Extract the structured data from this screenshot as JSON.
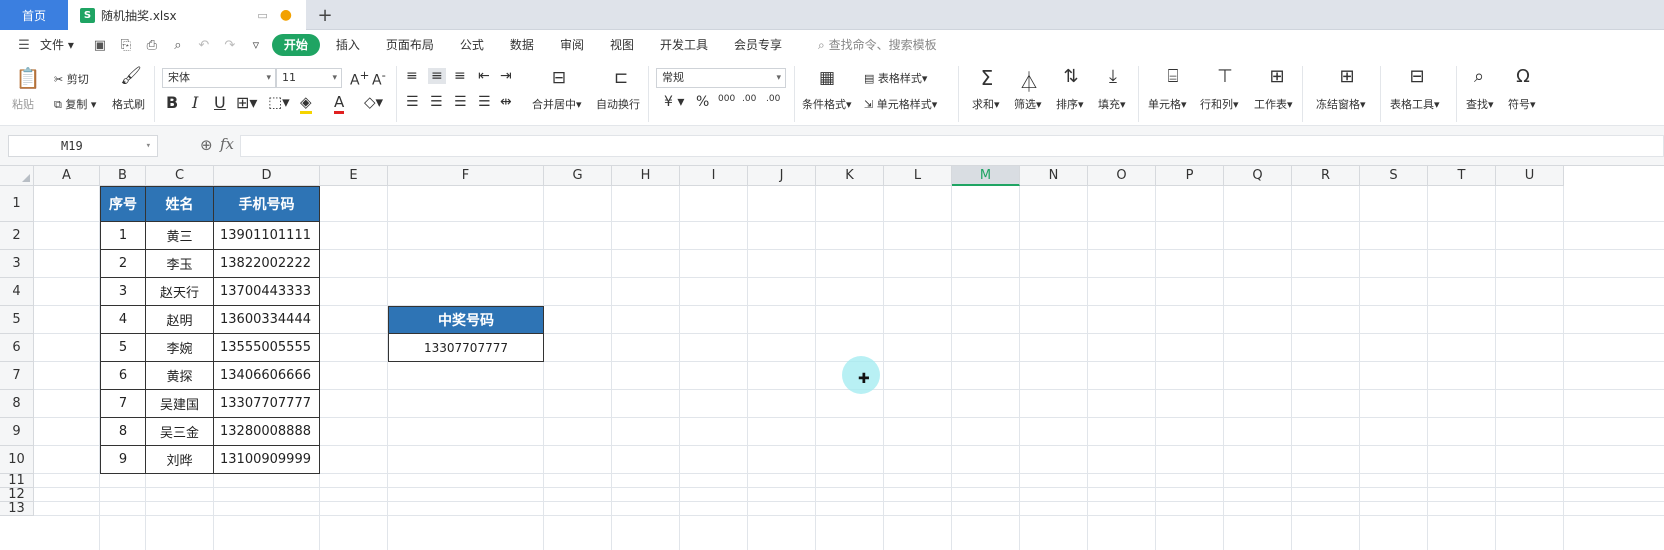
{
  "tabs": {
    "home": "首页",
    "file_name": "随机抽奖.xlsx",
    "file_icon_letter": "S",
    "monitor_icon": "monitor-icon",
    "unsaved_dot": "●",
    "plus": "+"
  },
  "menu": {
    "file": "文件",
    "items": [
      "开始",
      "插入",
      "页面布局",
      "公式",
      "数据",
      "审阅",
      "视图",
      "开发工具",
      "会员专享"
    ],
    "active_index": 0,
    "search": "查找命令、搜索模板"
  },
  "ribbon": {
    "paste": "粘贴",
    "cut": "剪切",
    "copy": "复制",
    "format_painter": "格式刷",
    "font_name": "宋体",
    "font_size": "11",
    "merge_center": "合并居中",
    "wrap_text": "自动换行",
    "number_format": "常规",
    "cond_format": "条件格式",
    "table_style": "表格样式",
    "cell_style": "单元格样式",
    "sum": "求和",
    "filter": "筛选",
    "sort": "排序",
    "fill": "填充",
    "cell": "单元格",
    "row_col": "行和列",
    "worksheet": "工作表",
    "freeze": "冻结窗格",
    "table_tools": "表格工具",
    "find": "查找",
    "symbol": "符号"
  },
  "formula_bar": {
    "name_box": "M19",
    "fx": "fx",
    "content": ""
  },
  "sheet": {
    "columns": [
      "A",
      "B",
      "C",
      "D",
      "E",
      "F",
      "G",
      "H",
      "I",
      "J",
      "K",
      "L",
      "M",
      "N",
      "O",
      "P",
      "Q",
      "R",
      "S",
      "T",
      "U"
    ],
    "selected_column": "M",
    "rows": [
      "1",
      "2",
      "3",
      "4",
      "5",
      "6",
      "7",
      "8",
      "9",
      "10",
      "11",
      "12",
      "13"
    ]
  },
  "table": {
    "headers": [
      "序号",
      "姓名",
      "手机号码"
    ],
    "rows": [
      [
        "1",
        "黄三",
        "13901101111"
      ],
      [
        "2",
        "李玉",
        "13822002222"
      ],
      [
        "3",
        "赵天行",
        "13700443333"
      ],
      [
        "4",
        "赵明",
        "13600334444"
      ],
      [
        "5",
        "李婉",
        "13555005555"
      ],
      [
        "6",
        "黄探",
        "13406606666"
      ],
      [
        "7",
        "吴建国",
        "13307707777"
      ],
      [
        "8",
        "吴三金",
        "13280008888"
      ],
      [
        "9",
        "刘晔",
        "13100909999"
      ]
    ]
  },
  "winner": {
    "header": "中奖号码",
    "value": "13307707777"
  },
  "colors": {
    "header_fill": "#2e74b5",
    "accent_green": "#1fa463",
    "home_tab": "#3b7fe0"
  }
}
